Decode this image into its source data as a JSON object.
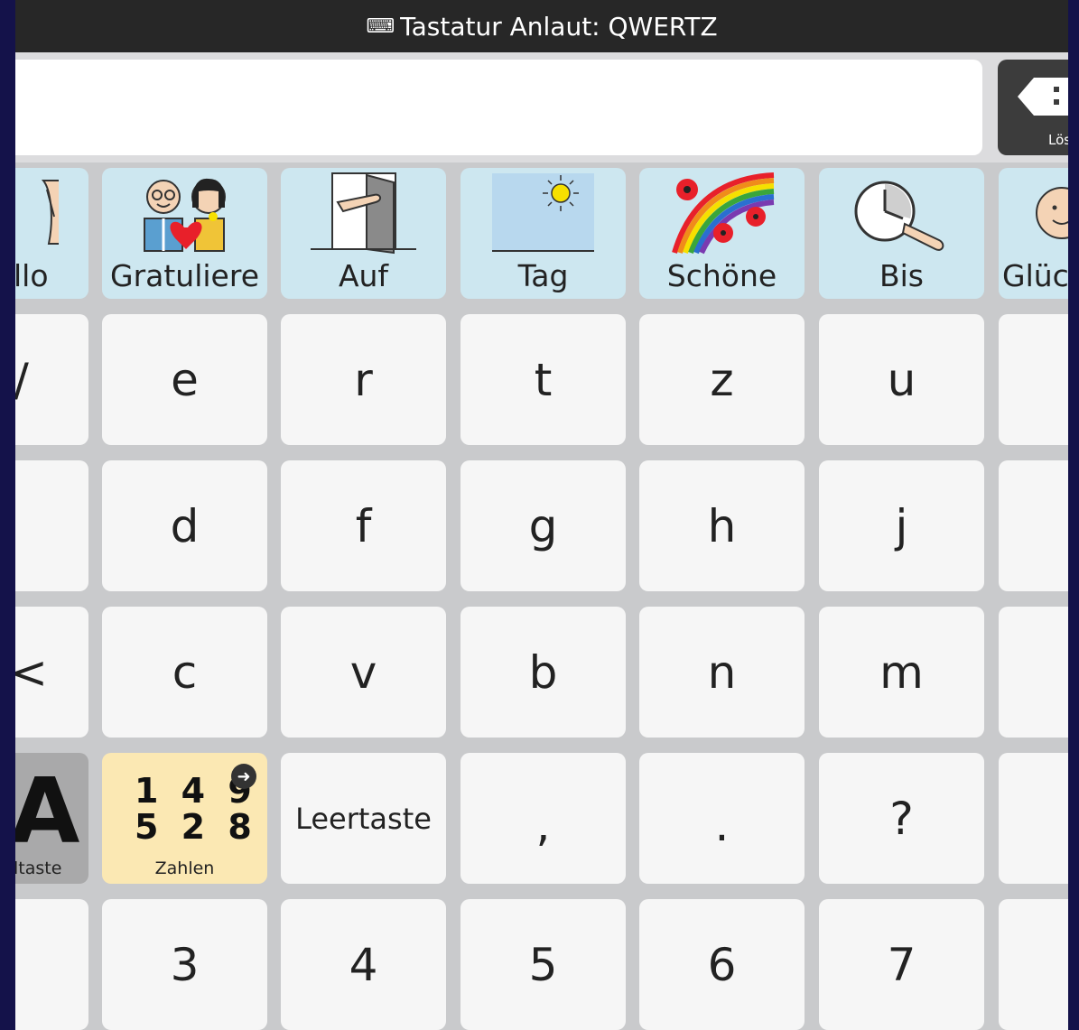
{
  "title": {
    "icon": "keyboard-icon",
    "text": "Tastatur Anlaut: QWERTZ"
  },
  "message_bar": {
    "text": ""
  },
  "delete_button": {
    "label": "Lös",
    "icon": "backspace-icon"
  },
  "word_row": [
    "llo",
    "Gratuliere",
    "Auf",
    "Tag",
    "Schöne",
    "Bis",
    "Glüc"
  ],
  "row1": [
    "",
    "e",
    "r",
    "t",
    "z",
    "u",
    ""
  ],
  "row2": [
    "",
    "d",
    "f",
    "g",
    "h",
    "j",
    ""
  ],
  "row3": [
    "",
    "c",
    "v",
    "b",
    "n",
    "m",
    ""
  ],
  "row4": {
    "shift_label": "ltaste",
    "shift_glyph": "A",
    "zahlen_digits_line1": "1 4 9",
    "zahlen_digits_line2": "5 2 8",
    "zahlen_label": "Zahlen",
    "space_label": "Leertaste",
    "comma": ",",
    "period": ".",
    "question": "?"
  },
  "row5": [
    "",
    "3",
    "4",
    "5",
    "6",
    "7",
    ""
  ],
  "colors": {
    "word_cell": "#cde7f0",
    "key_cell": "#f6f6f6",
    "zahlen_cell": "#fbe8b3",
    "shift_cell": "#a9a9aa",
    "titlebar": "#272727"
  }
}
